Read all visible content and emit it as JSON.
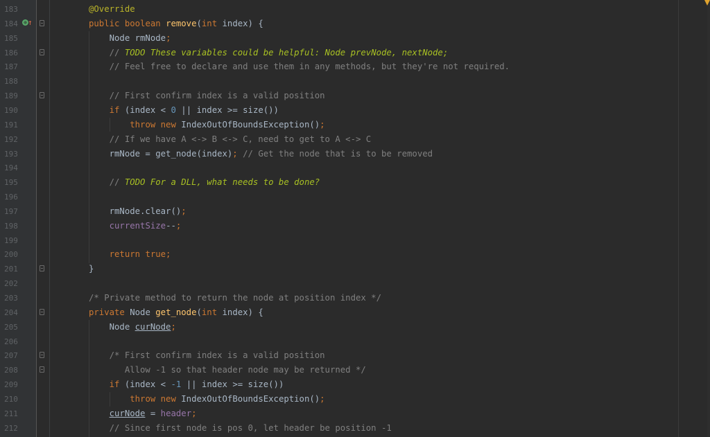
{
  "editor": {
    "lines": [
      {
        "n": "183",
        "tokens": [
          {
            "t": "@Override",
            "c": "ann"
          }
        ]
      },
      {
        "n": "184",
        "tokens": [
          {
            "t": "public ",
            "c": "kw"
          },
          {
            "t": "boolean ",
            "c": "kw"
          },
          {
            "t": "remove",
            "c": "fn"
          },
          {
            "t": "(",
            "c": ""
          },
          {
            "t": "int ",
            "c": "kw"
          },
          {
            "t": "index) {",
            "c": ""
          }
        ]
      },
      {
        "n": "185",
        "tokens": [
          {
            "t": "    Node rmNode",
            "c": ""
          },
          {
            "t": ";",
            "c": "kw"
          }
        ]
      },
      {
        "n": "186",
        "tokens": [
          {
            "t": "    // ",
            "c": "cm"
          },
          {
            "t": "TODO These variables could be helpful: Node prevNode, nextNode;",
            "c": "todo"
          }
        ]
      },
      {
        "n": "187",
        "tokens": [
          {
            "t": "    // Feel free to declare and use them in any methods, but they're not required.",
            "c": "cm"
          }
        ]
      },
      {
        "n": "188",
        "tokens": []
      },
      {
        "n": "189",
        "tokens": [
          {
            "t": "    // First confirm index is a valid position",
            "c": "cm"
          }
        ]
      },
      {
        "n": "190",
        "tokens": [
          {
            "t": "    ",
            "c": ""
          },
          {
            "t": "if ",
            "c": "kw"
          },
          {
            "t": "(index < ",
            "c": ""
          },
          {
            "t": "0",
            "c": "num"
          },
          {
            "t": " || index >= size())",
            "c": ""
          }
        ]
      },
      {
        "n": "191",
        "tokens": [
          {
            "t": "        ",
            "c": ""
          },
          {
            "t": "throw new ",
            "c": "kw"
          },
          {
            "t": "IndexOutOfBoundsException()",
            "c": ""
          },
          {
            "t": ";",
            "c": "kw"
          }
        ]
      },
      {
        "n": "192",
        "tokens": [
          {
            "t": "    // If we have A <-> B <-> C, need to get to A <-> C",
            "c": "cm"
          }
        ]
      },
      {
        "n": "193",
        "tokens": [
          {
            "t": "    rmNode = get_node(index)",
            "c": ""
          },
          {
            "t": "; ",
            "c": "kw"
          },
          {
            "t": "// Get the node that is to be removed",
            "c": "cm"
          }
        ]
      },
      {
        "n": "194",
        "tokens": []
      },
      {
        "n": "195",
        "tokens": [
          {
            "t": "    // ",
            "c": "cm"
          },
          {
            "t": "TODO For a DLL, what needs to be done?",
            "c": "todo"
          }
        ]
      },
      {
        "n": "196",
        "tokens": []
      },
      {
        "n": "197",
        "tokens": [
          {
            "t": "    rmNode.clear()",
            "c": ""
          },
          {
            "t": ";",
            "c": "kw"
          }
        ]
      },
      {
        "n": "198",
        "tokens": [
          {
            "t": "    ",
            "c": ""
          },
          {
            "t": "currentSize",
            "c": "field"
          },
          {
            "t": "--",
            "c": ""
          },
          {
            "t": ";",
            "c": "kw"
          }
        ]
      },
      {
        "n": "199",
        "tokens": []
      },
      {
        "n": "200",
        "tokens": [
          {
            "t": "    ",
            "c": ""
          },
          {
            "t": "return true;",
            "c": "kw"
          }
        ]
      },
      {
        "n": "201",
        "tokens": [
          {
            "t": "}",
            "c": ""
          }
        ]
      },
      {
        "n": "202",
        "tokens": []
      },
      {
        "n": "203",
        "tokens": [
          {
            "t": "/* Private method to return the node at position index */",
            "c": "cm"
          }
        ]
      },
      {
        "n": "204",
        "tokens": [
          {
            "t": "private ",
            "c": "kw"
          },
          {
            "t": "Node ",
            "c": ""
          },
          {
            "t": "get_node",
            "c": "fn"
          },
          {
            "t": "(",
            "c": ""
          },
          {
            "t": "int ",
            "c": "kw"
          },
          {
            "t": "index) {",
            "c": ""
          }
        ]
      },
      {
        "n": "205",
        "tokens": [
          {
            "t": "    Node ",
            "c": ""
          },
          {
            "t": "curNode",
            "c": "u"
          },
          {
            "t": ";",
            "c": "kw"
          }
        ]
      },
      {
        "n": "206",
        "tokens": []
      },
      {
        "n": "207",
        "tokens": [
          {
            "t": "    /* First confirm index is a valid position",
            "c": "cm"
          }
        ]
      },
      {
        "n": "208",
        "tokens": [
          {
            "t": "       Allow -1 so that header node may be returned */",
            "c": "cm"
          }
        ]
      },
      {
        "n": "209",
        "tokens": [
          {
            "t": "    ",
            "c": ""
          },
          {
            "t": "if ",
            "c": "kw"
          },
          {
            "t": "(index < ",
            "c": ""
          },
          {
            "t": "-1",
            "c": "num"
          },
          {
            "t": " || index >= size())",
            "c": ""
          }
        ]
      },
      {
        "n": "210",
        "tokens": [
          {
            "t": "        ",
            "c": ""
          },
          {
            "t": "throw new ",
            "c": "kw"
          },
          {
            "t": "IndexOutOfBoundsException()",
            "c": ""
          },
          {
            "t": ";",
            "c": "kw"
          }
        ]
      },
      {
        "n": "211",
        "tokens": [
          {
            "t": "    ",
            "c": ""
          },
          {
            "t": "curNode",
            "c": "u"
          },
          {
            "t": " = ",
            "c": ""
          },
          {
            "t": "header",
            "c": "field"
          },
          {
            "t": ";",
            "c": "kw"
          }
        ]
      },
      {
        "n": "212",
        "tokens": [
          {
            "t": "    // Since first node is pos 0, let header be position -1",
            "c": "cm"
          }
        ]
      }
    ],
    "folds": [
      "184",
      "186",
      "189",
      "201",
      "204",
      "207",
      "208"
    ],
    "gutter_icons": {
      "override": "override-icon",
      "up_arrow": "up-arrow-icon"
    }
  }
}
